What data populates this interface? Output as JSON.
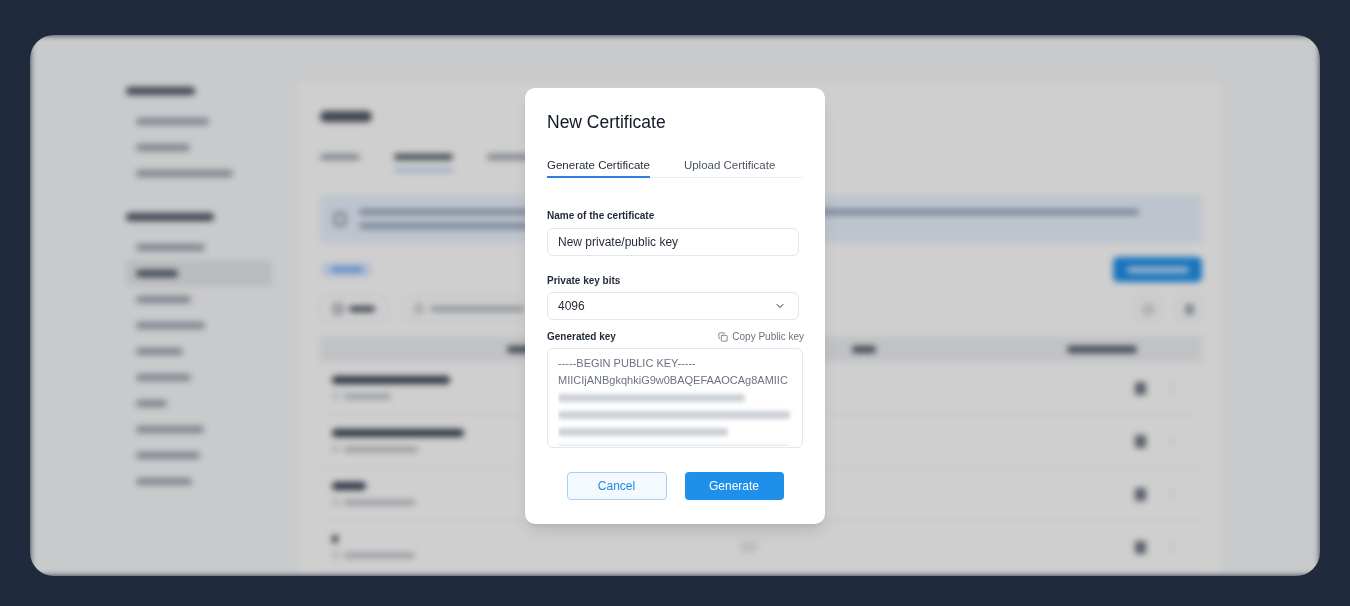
{
  "dialog": {
    "title": "New Certificate",
    "tabs": [
      {
        "label": "Generate Certificate",
        "selected": true
      },
      {
        "label": "Upload Certificate",
        "selected": false
      }
    ],
    "name_field": {
      "label": "Name of the certificate",
      "value": "New private/public key"
    },
    "bits_field": {
      "label": "Private key bits",
      "value": "4096"
    },
    "key_field": {
      "label": "Generated key",
      "copy_link": "Copy Public key",
      "lines": [
        "-----BEGIN PUBLIC KEY-----",
        "MIICIjANBgkqhkiG9w0BAQEFAAOCAg8AMIIC"
      ]
    },
    "buttons": [
      {
        "label": "Cancel",
        "kind": "cancel"
      },
      {
        "label": "Generate",
        "kind": "submit"
      }
    ]
  }
}
